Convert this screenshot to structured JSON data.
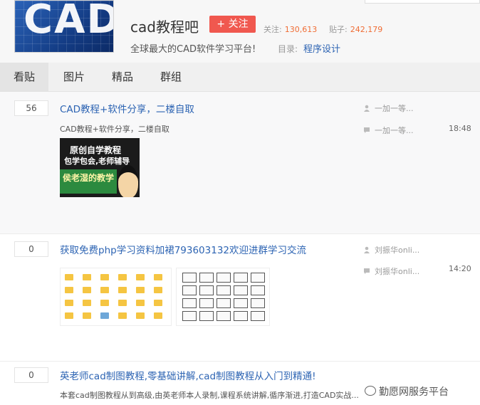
{
  "forum": {
    "name": "cad教程吧",
    "follow_label": "+ 关注",
    "follow_stat_label": "关注:",
    "follow_count": "130,613",
    "post_stat_label": "贴子:",
    "post_count": "242,179",
    "slogan": "全球最大的CAD软件学习平台!",
    "directory_label": "目录:",
    "directory_value": "程序设计",
    "logo_text": "CAD"
  },
  "tabs": [
    {
      "label": "看贴",
      "active": true
    },
    {
      "label": "图片",
      "active": false
    },
    {
      "label": "精品",
      "active": false
    },
    {
      "label": "群组",
      "active": false
    }
  ],
  "posts": [
    {
      "replies": "56",
      "title": "CAD教程+软件分享，二楼自取",
      "excerpt": "CAD教程+软件分享，二楼自取",
      "author": "一加一等...",
      "last_reply": "一加一等...",
      "time": "18:48",
      "promo": {
        "line1": "原创自学教程",
        "line2": "包学包会,老师辅导",
        "name": "侯老湿的教学"
      }
    },
    {
      "replies": "0",
      "title": "获取免费php学习资料加裙793603132欢迎进群学习交流",
      "author": "刘振华onli...",
      "last_reply": "刘振华onli...",
      "time": "14:20"
    },
    {
      "replies": "0",
      "title": "英老师cad制图教程,零基础讲解,cad制图教程从入门到精通!",
      "excerpt": "本套cad制图教程从到高级,由英老师本人录制,课程系统讲解,循序渐进,打造CAD实战..."
    }
  ],
  "watermark": "勤愿网服务平台",
  "colors": {
    "accent_link": "#2d64b3",
    "follow_button": "#f0584f",
    "stat_number": "#f06d35"
  }
}
